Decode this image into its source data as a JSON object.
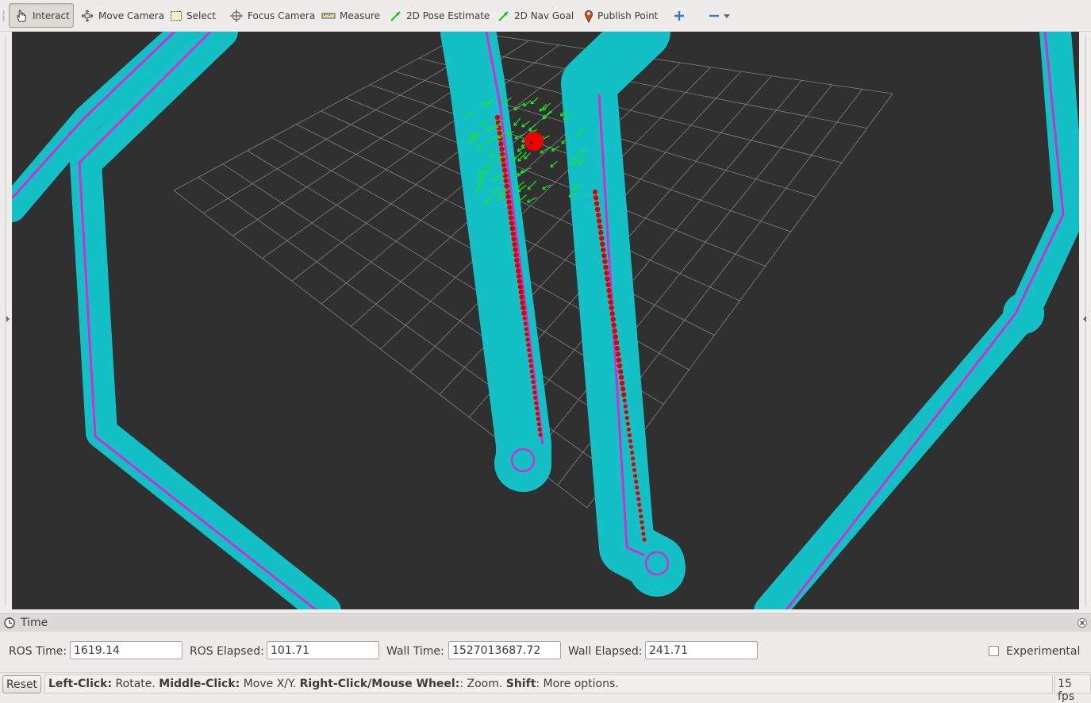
{
  "toolbar": {
    "tools": [
      {
        "label": "Interact",
        "icon": "hand-icon",
        "active": true
      },
      {
        "label": "Move Camera",
        "icon": "move-camera-icon"
      },
      {
        "label": "Select",
        "icon": "select-box-icon"
      },
      {
        "label": "Focus Camera",
        "icon": "crosshair-icon"
      },
      {
        "label": "Measure",
        "icon": "ruler-icon"
      },
      {
        "label": "2D Pose Estimate",
        "icon": "green-arrow-icon"
      },
      {
        "label": "2D Nav Goal",
        "icon": "green-arrow-icon"
      },
      {
        "label": "Publish Point",
        "icon": "map-pin-icon"
      }
    ],
    "add_icon": "plus-icon",
    "remove_icon": "minus-icon"
  },
  "viewport": {
    "background_color": "#303030",
    "costmap_color": "#14c2c8",
    "obstacle_color": "#d030d0",
    "plan_color": "#e00000",
    "particle_color": "#22e022",
    "grid_color": "#a0a0a0"
  },
  "time_panel": {
    "title": "Time",
    "ros_time_label": "ROS Time:",
    "ros_time": "1619.14",
    "ros_elapsed_label": "ROS Elapsed:",
    "ros_elapsed": "101.71",
    "wall_time_label": "Wall Time:",
    "wall_time": "1527013687.72",
    "wall_elapsed_label": "Wall Elapsed:",
    "wall_elapsed": "241.71",
    "experimental_label": "Experimental",
    "experimental_checked": false
  },
  "status_bar": {
    "reset_label": "Reset",
    "hint_left_click": "Left-Click:",
    "hint_rotate": " Rotate. ",
    "hint_middle_click": "Middle-Click:",
    "hint_move": " Move X/Y. ",
    "hint_right_click": "Right-Click/Mouse Wheel:",
    "hint_zoom": ": Zoom. ",
    "hint_shift": "Shift",
    "hint_more": ": More options.",
    "fps": "15 fps"
  }
}
